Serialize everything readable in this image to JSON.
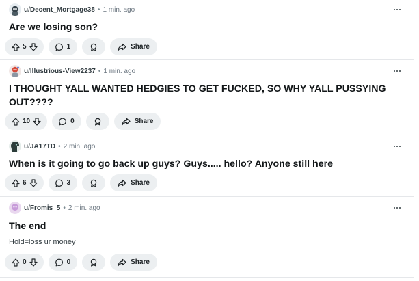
{
  "colors": {
    "pill_bg": "#eceff1",
    "text_primary": "#131719",
    "text_meta": "#6b7680",
    "divider": "#e5e7ea"
  },
  "actions": {
    "share_label": "Share"
  },
  "posts": [
    {
      "username": "u/Decent_Mortgage38",
      "separator": "•",
      "time": "1 min. ago",
      "title": "Are we losing son?",
      "body": "",
      "votes": "5",
      "comments": "1",
      "avatar_icon": "snoo-avatar-icon"
    },
    {
      "username": "u/Illustrious-View2237",
      "separator": "•",
      "time": "1 min. ago",
      "title": "I THOUGHT YALL WANTED HEDGIES TO GET FUCKED, SO WHY YALL PUSSYING OUT????",
      "body": "",
      "votes": "10",
      "comments": "0",
      "avatar_icon": "snoo-avatar-icon"
    },
    {
      "username": "u/JA17TD",
      "separator": "•",
      "time": "2 min. ago",
      "title": "When is it going to go back up guys? Guys..... hello? Anyone still here",
      "body": "",
      "votes": "6",
      "comments": "3",
      "avatar_icon": "snoo-avatar-icon"
    },
    {
      "username": "u/Fromis_5",
      "separator": "•",
      "time": "2 min. ago",
      "title": "The end",
      "body": "Hold=loss ur money",
      "votes": "0",
      "comments": "0",
      "avatar_icon": "snoo-avatar-icon"
    }
  ]
}
